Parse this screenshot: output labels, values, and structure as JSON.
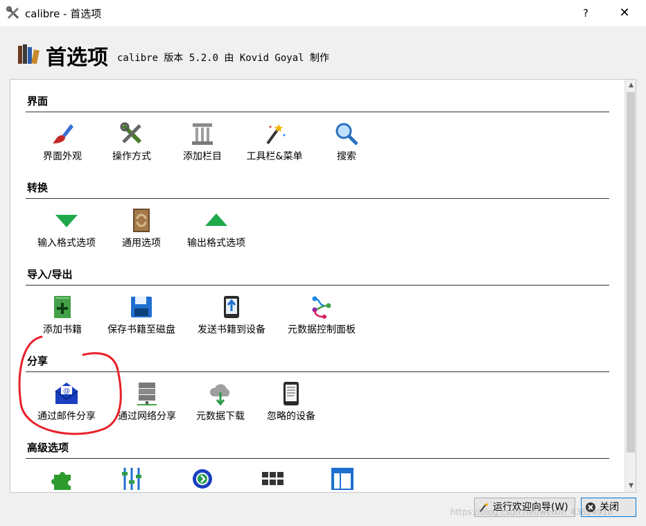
{
  "window": {
    "title": "calibre - 首选项",
    "help_label": "?",
    "close_label": "✕"
  },
  "header": {
    "title": "首选项",
    "version": "calibre 版本 5.2.0 由 Kovid Goyal 制作"
  },
  "sections": [
    {
      "title": "界面",
      "items": [
        {
          "label": "界面外观",
          "icon": "paint-brush-icon"
        },
        {
          "label": "操作方式",
          "icon": "tools-icon"
        },
        {
          "label": "添加栏目",
          "icon": "column-pillar-icon"
        },
        {
          "label": "工具栏&菜单",
          "icon": "magic-wand-icon"
        },
        {
          "label": "搜索",
          "icon": "search-icon"
        }
      ]
    },
    {
      "title": "转换",
      "items": [
        {
          "label": "输入格式选项",
          "icon": "arrow-down-icon"
        },
        {
          "label": "通用选项",
          "icon": "book-convert-icon"
        },
        {
          "label": "输出格式选项",
          "icon": "arrow-up-icon"
        }
      ]
    },
    {
      "title": "导入/导出",
      "items": [
        {
          "label": "添加书籍",
          "icon": "add-book-icon"
        },
        {
          "label": "保存书籍至磁盘",
          "icon": "floppy-disk-icon"
        },
        {
          "label": "发送书籍到设备",
          "icon": "send-to-device-icon"
        },
        {
          "label": "元数据控制面板",
          "icon": "metadata-plugboard-icon"
        }
      ]
    },
    {
      "title": "分享",
      "items": [
        {
          "label": "通过邮件分享",
          "icon": "email-envelope-icon"
        },
        {
          "label": "通过网络分享",
          "icon": "server-icon"
        },
        {
          "label": "元数据下载",
          "icon": "cloud-download-icon"
        },
        {
          "label": "忽略的设备",
          "icon": "ebook-reader-icon"
        }
      ]
    },
    {
      "title": "高级选项",
      "items": [
        {
          "label": "",
          "icon": "puzzle-plugin-icon"
        },
        {
          "label": "",
          "icon": "sliders-tweaks-icon"
        },
        {
          "label": "",
          "icon": "gear-icon"
        },
        {
          "label": "",
          "icon": "keyboard-shortcuts-icon"
        },
        {
          "label": "",
          "icon": "layout-panels-icon"
        }
      ]
    }
  ],
  "footer": {
    "wizard_label": "运行欢迎向导(W)",
    "close_label": "关闭",
    "watermark": "https://blog.csdn.net/weixin_43624910"
  },
  "colors": {
    "annotation_circle": "#e8202a",
    "close_button_border": "#0078d7"
  }
}
